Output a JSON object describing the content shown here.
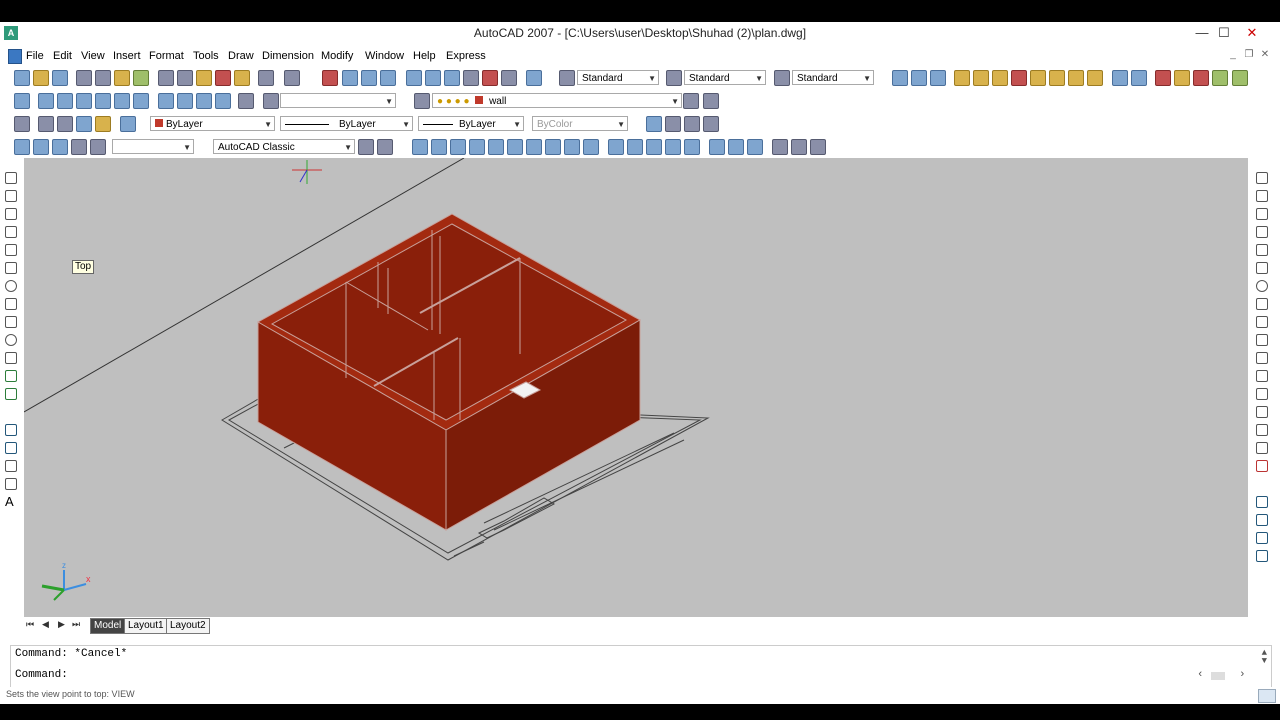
{
  "window": {
    "title": "AutoCAD 2007 - [C:\\Users\\user\\Desktop\\Shuhad (2)\\plan.dwg]",
    "app_icon": "autocad-logo",
    "controls": {
      "minimize": "—",
      "maximize": "☐",
      "close": "✕"
    }
  },
  "menu": {
    "items": [
      "File",
      "Edit",
      "View",
      "Insert",
      "Format",
      "Tools",
      "Draw",
      "Dimension",
      "Modify",
      "Window",
      "Help",
      "Express"
    ],
    "mdi_controls": {
      "minimize": "_",
      "restore": "❐",
      "close": "✕"
    }
  },
  "toolbar_styles": {
    "text_style": "Standard",
    "dim_style": "Standard",
    "table_style": "Standard"
  },
  "layers": {
    "current_layer": "wall",
    "layer_color": "#c0392b"
  },
  "properties": {
    "color": "ByLayer",
    "linetype": "ByLayer",
    "lineweight": "ByLayer",
    "plotstyle": "ByColor"
  },
  "workspace": {
    "current": "AutoCAD Classic"
  },
  "tooltip": {
    "text": "Top"
  },
  "layout_tabs": {
    "nav": [
      "⏮",
      "◀",
      "▶",
      "⏭"
    ],
    "tabs": [
      {
        "label": "Model",
        "active": true
      },
      {
        "label": "Layout1",
        "active": false
      },
      {
        "label": "Layout2",
        "active": false
      }
    ]
  },
  "command": {
    "history": "Command: *Cancel*",
    "prompt": "Command:",
    "scroll_left": "‹",
    "scroll_right": "›"
  },
  "status": {
    "text": "Sets the view point to top: VIEW"
  },
  "colors": {
    "viewport_bg": "#bfbfbf",
    "wall_top": "#a32a10",
    "wall_left": "#8a1f0a",
    "wall_right": "#7c1c08"
  }
}
